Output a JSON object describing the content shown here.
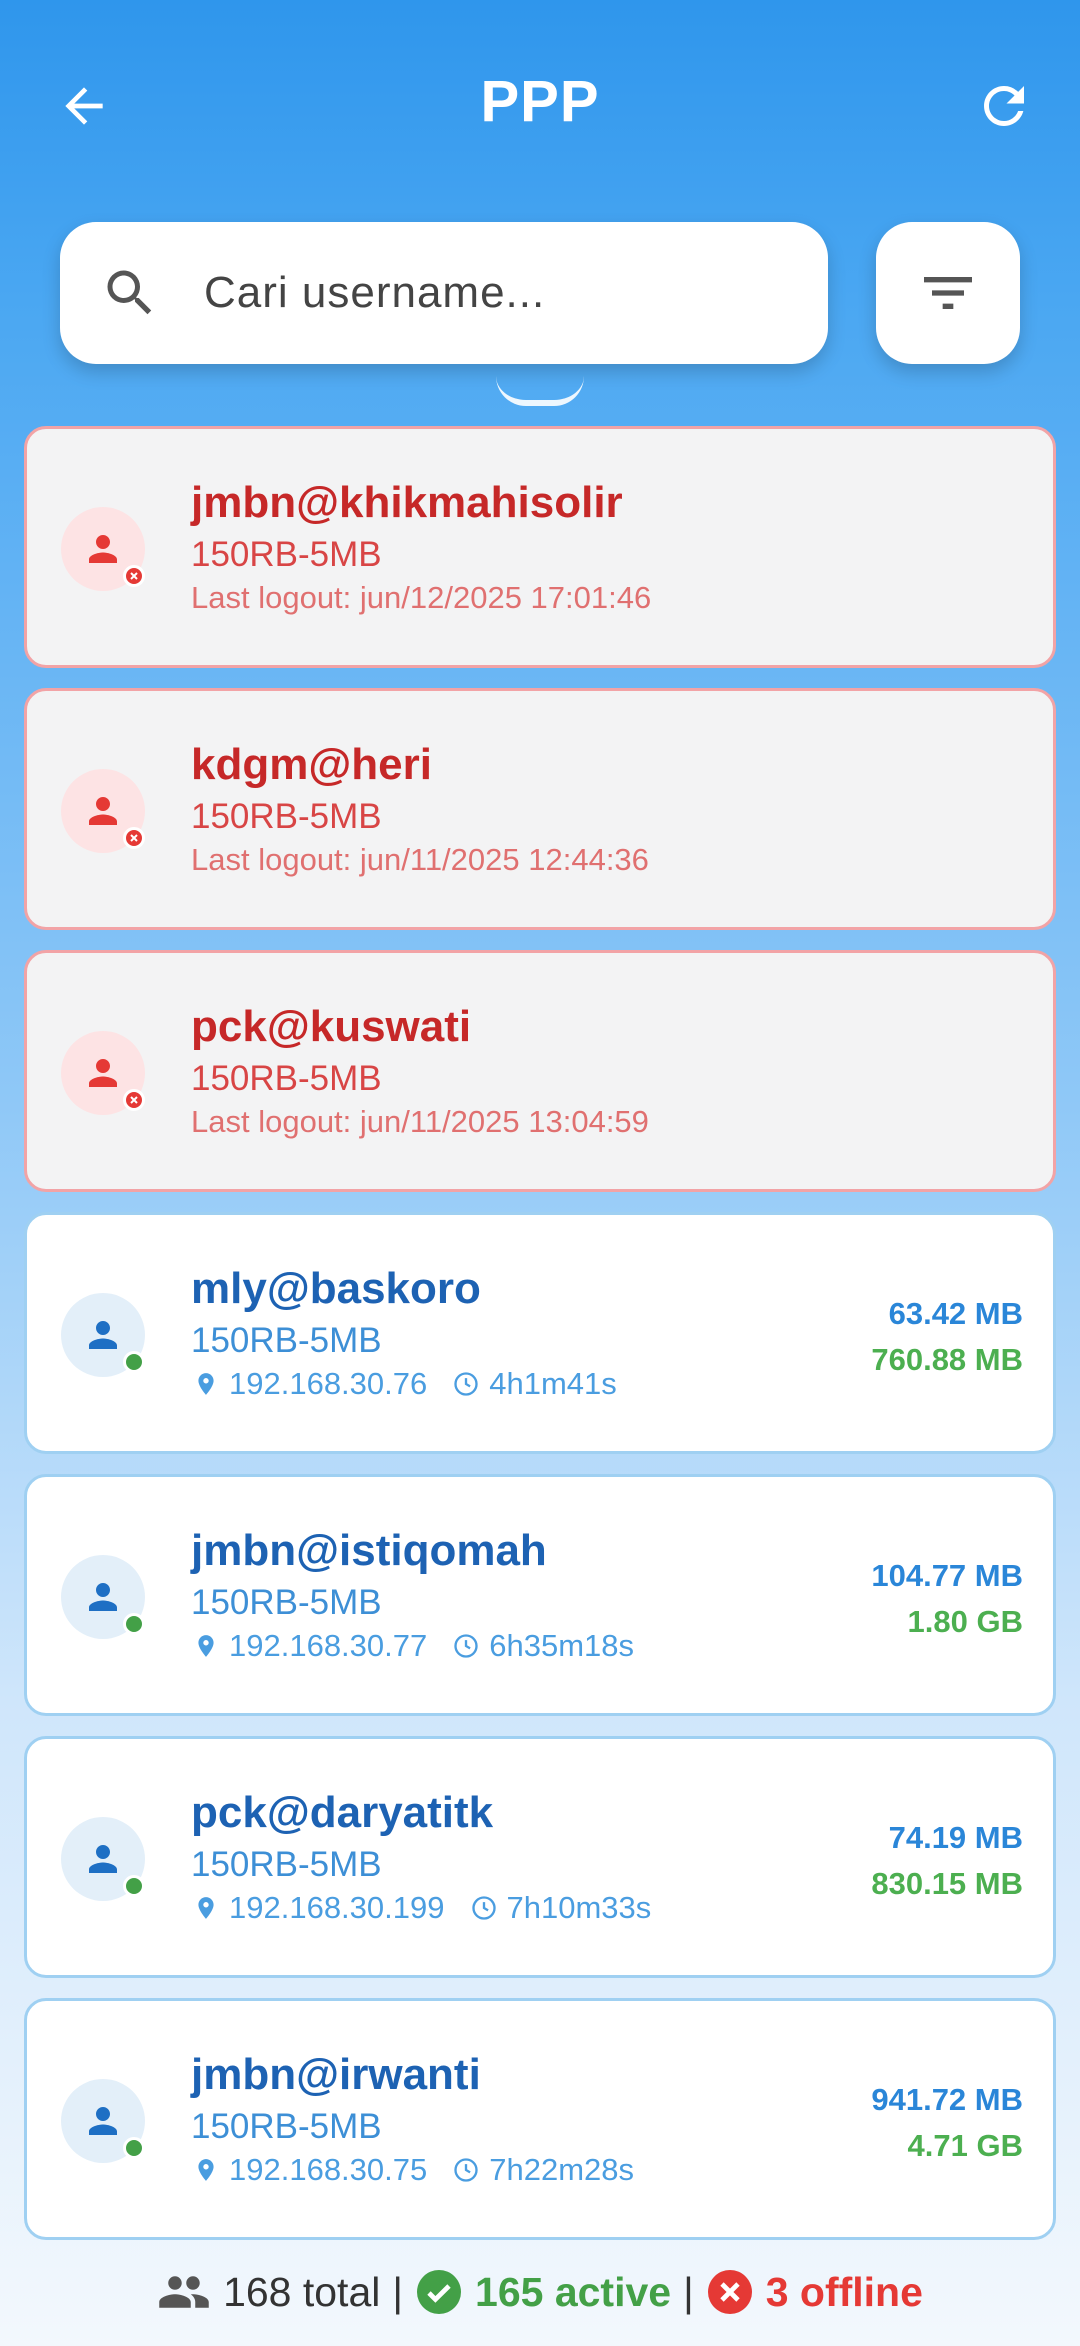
{
  "header": {
    "title": "PPP",
    "back_icon": "arrow-left-icon",
    "refresh_icon": "refresh-icon"
  },
  "search": {
    "placeholder": "Cari username...",
    "value": ""
  },
  "colors": {
    "accent": "#2f96ec",
    "offline_red": "#c62828",
    "online_blue": "#1d62b3",
    "active_green": "#43a047"
  },
  "users": [
    {
      "status": "offline",
      "username": "jmbn@khikmahisolir",
      "profile": "150RB-5MB",
      "last_logout": "Last logout: jun/12/2025 17:01:46"
    },
    {
      "status": "offline",
      "username": "kdgm@heri",
      "profile": "150RB-5MB",
      "last_logout": "Last logout: jun/11/2025 12:44:36"
    },
    {
      "status": "offline",
      "username": "pck@kuswati",
      "profile": "150RB-5MB",
      "last_logout": "Last logout: jun/11/2025 13:04:59"
    },
    {
      "status": "online",
      "username": "mly@baskoro",
      "profile": "150RB-5MB",
      "ip": "192.168.30.76",
      "uptime": "4h1m41s",
      "tx": "63.42 MB",
      "rx": "760.88 MB"
    },
    {
      "status": "online",
      "username": "jmbn@istiqomah",
      "profile": "150RB-5MB",
      "ip": "192.168.30.77",
      "uptime": "6h35m18s",
      "tx": "104.77 MB",
      "rx": "1.80 GB"
    },
    {
      "status": "online",
      "username": "pck@daryatitk",
      "profile": "150RB-5MB",
      "ip": "192.168.30.199",
      "uptime": "7h10m33s",
      "tx": "74.19 MB",
      "rx": "830.15 MB"
    },
    {
      "status": "online",
      "username": "jmbn@irwanti",
      "profile": "150RB-5MB",
      "ip": "192.168.30.75",
      "uptime": "7h22m28s",
      "tx": "941.72 MB",
      "rx": "4.71 GB"
    }
  ],
  "footer": {
    "total": "168 total",
    "sep": "|",
    "active": "165 active",
    "offline": "3 offline"
  }
}
